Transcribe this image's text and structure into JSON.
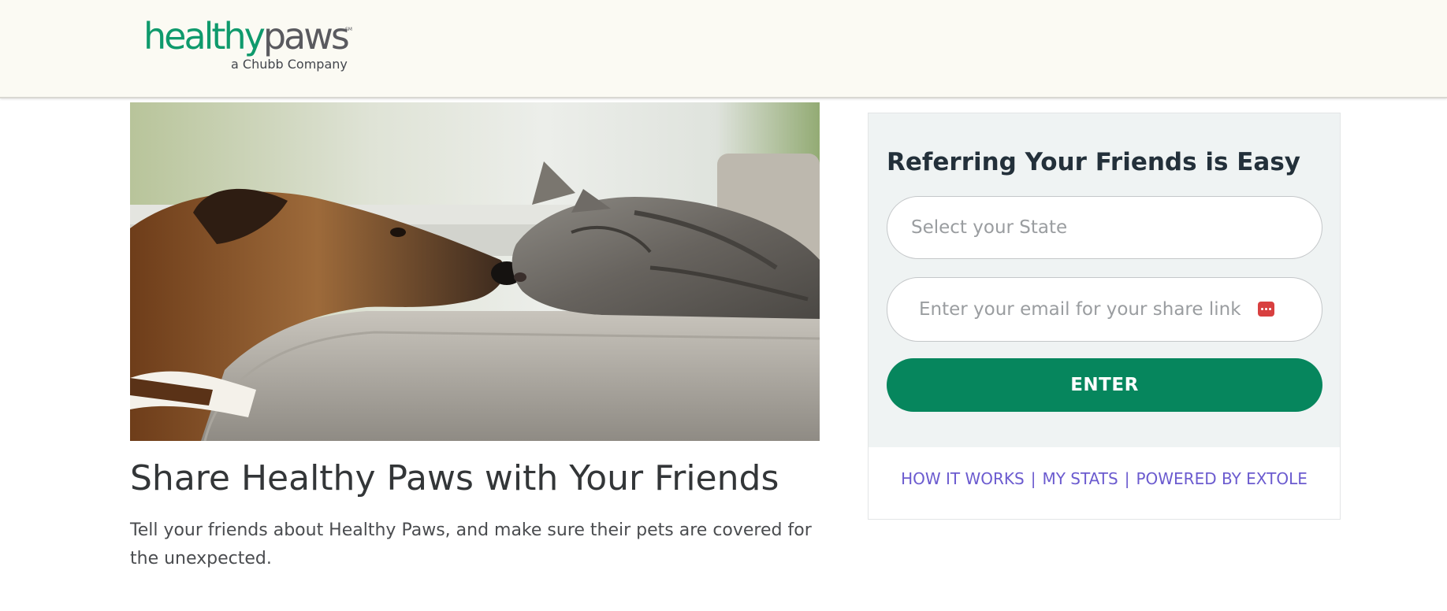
{
  "header": {
    "logo": {
      "word_healthy": "healthy",
      "word_paws": "paws",
      "mark": "SM",
      "tagline": "a Chubb Company"
    }
  },
  "hero": {
    "image_alt": "Dog and cat touching noses on a couch"
  },
  "main": {
    "title": "Share Healthy Paws with Your Friends",
    "description": "Tell your friends about Healthy Paws, and make sure their pets are covered for the unexpected."
  },
  "referral": {
    "title": "Referring Your Friends is Easy",
    "state_placeholder": "Select your State",
    "email_placeholder": "Enter your email for your share link",
    "enter_label": "ENTER",
    "links": {
      "how_it_works": "HOW IT WORKS",
      "my_stats": "MY STATS",
      "powered_by": "POWERED BY EXTOLE",
      "separator": "|"
    }
  },
  "colors": {
    "brand_green": "#06865d",
    "logo_green": "#0f9a6c",
    "link_purple": "#6b5bcf",
    "header_bg": "#fbfaf3"
  },
  "icons": {
    "autofill": "password-manager-icon"
  }
}
